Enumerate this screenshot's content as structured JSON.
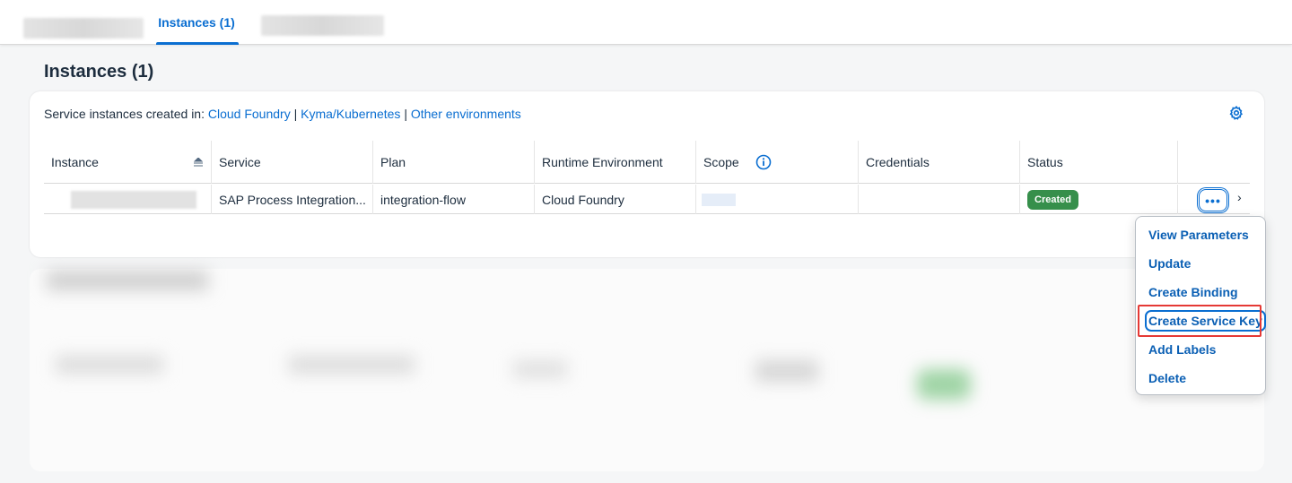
{
  "tabs": {
    "active_label": "Instances (1)"
  },
  "page_title": "Instances (1)",
  "created_in": {
    "prefix": "Service instances created in:",
    "links": [
      "Cloud Foundry",
      "Kyma/Kubernetes",
      "Other environments"
    ],
    "separator": "|"
  },
  "table": {
    "headers": [
      "Instance",
      "Service",
      "Plan",
      "Runtime Environment",
      "Scope",
      "Credentials",
      "Status"
    ],
    "row": {
      "service": "SAP Process Integration...",
      "plan": "integration-flow",
      "runtime": "Cloud Foundry",
      "credentials": "",
      "status": "Created",
      "more": "•••",
      "chevron": "›"
    }
  },
  "menu": {
    "items": [
      "View Parameters",
      "Update",
      "Create Binding",
      "Create Service Key",
      "Add Labels",
      "Delete"
    ],
    "focused_index": 3
  },
  "colors": {
    "link": "#0a6ed1",
    "status_created": "#368f4b",
    "highlight": "#e53935"
  }
}
